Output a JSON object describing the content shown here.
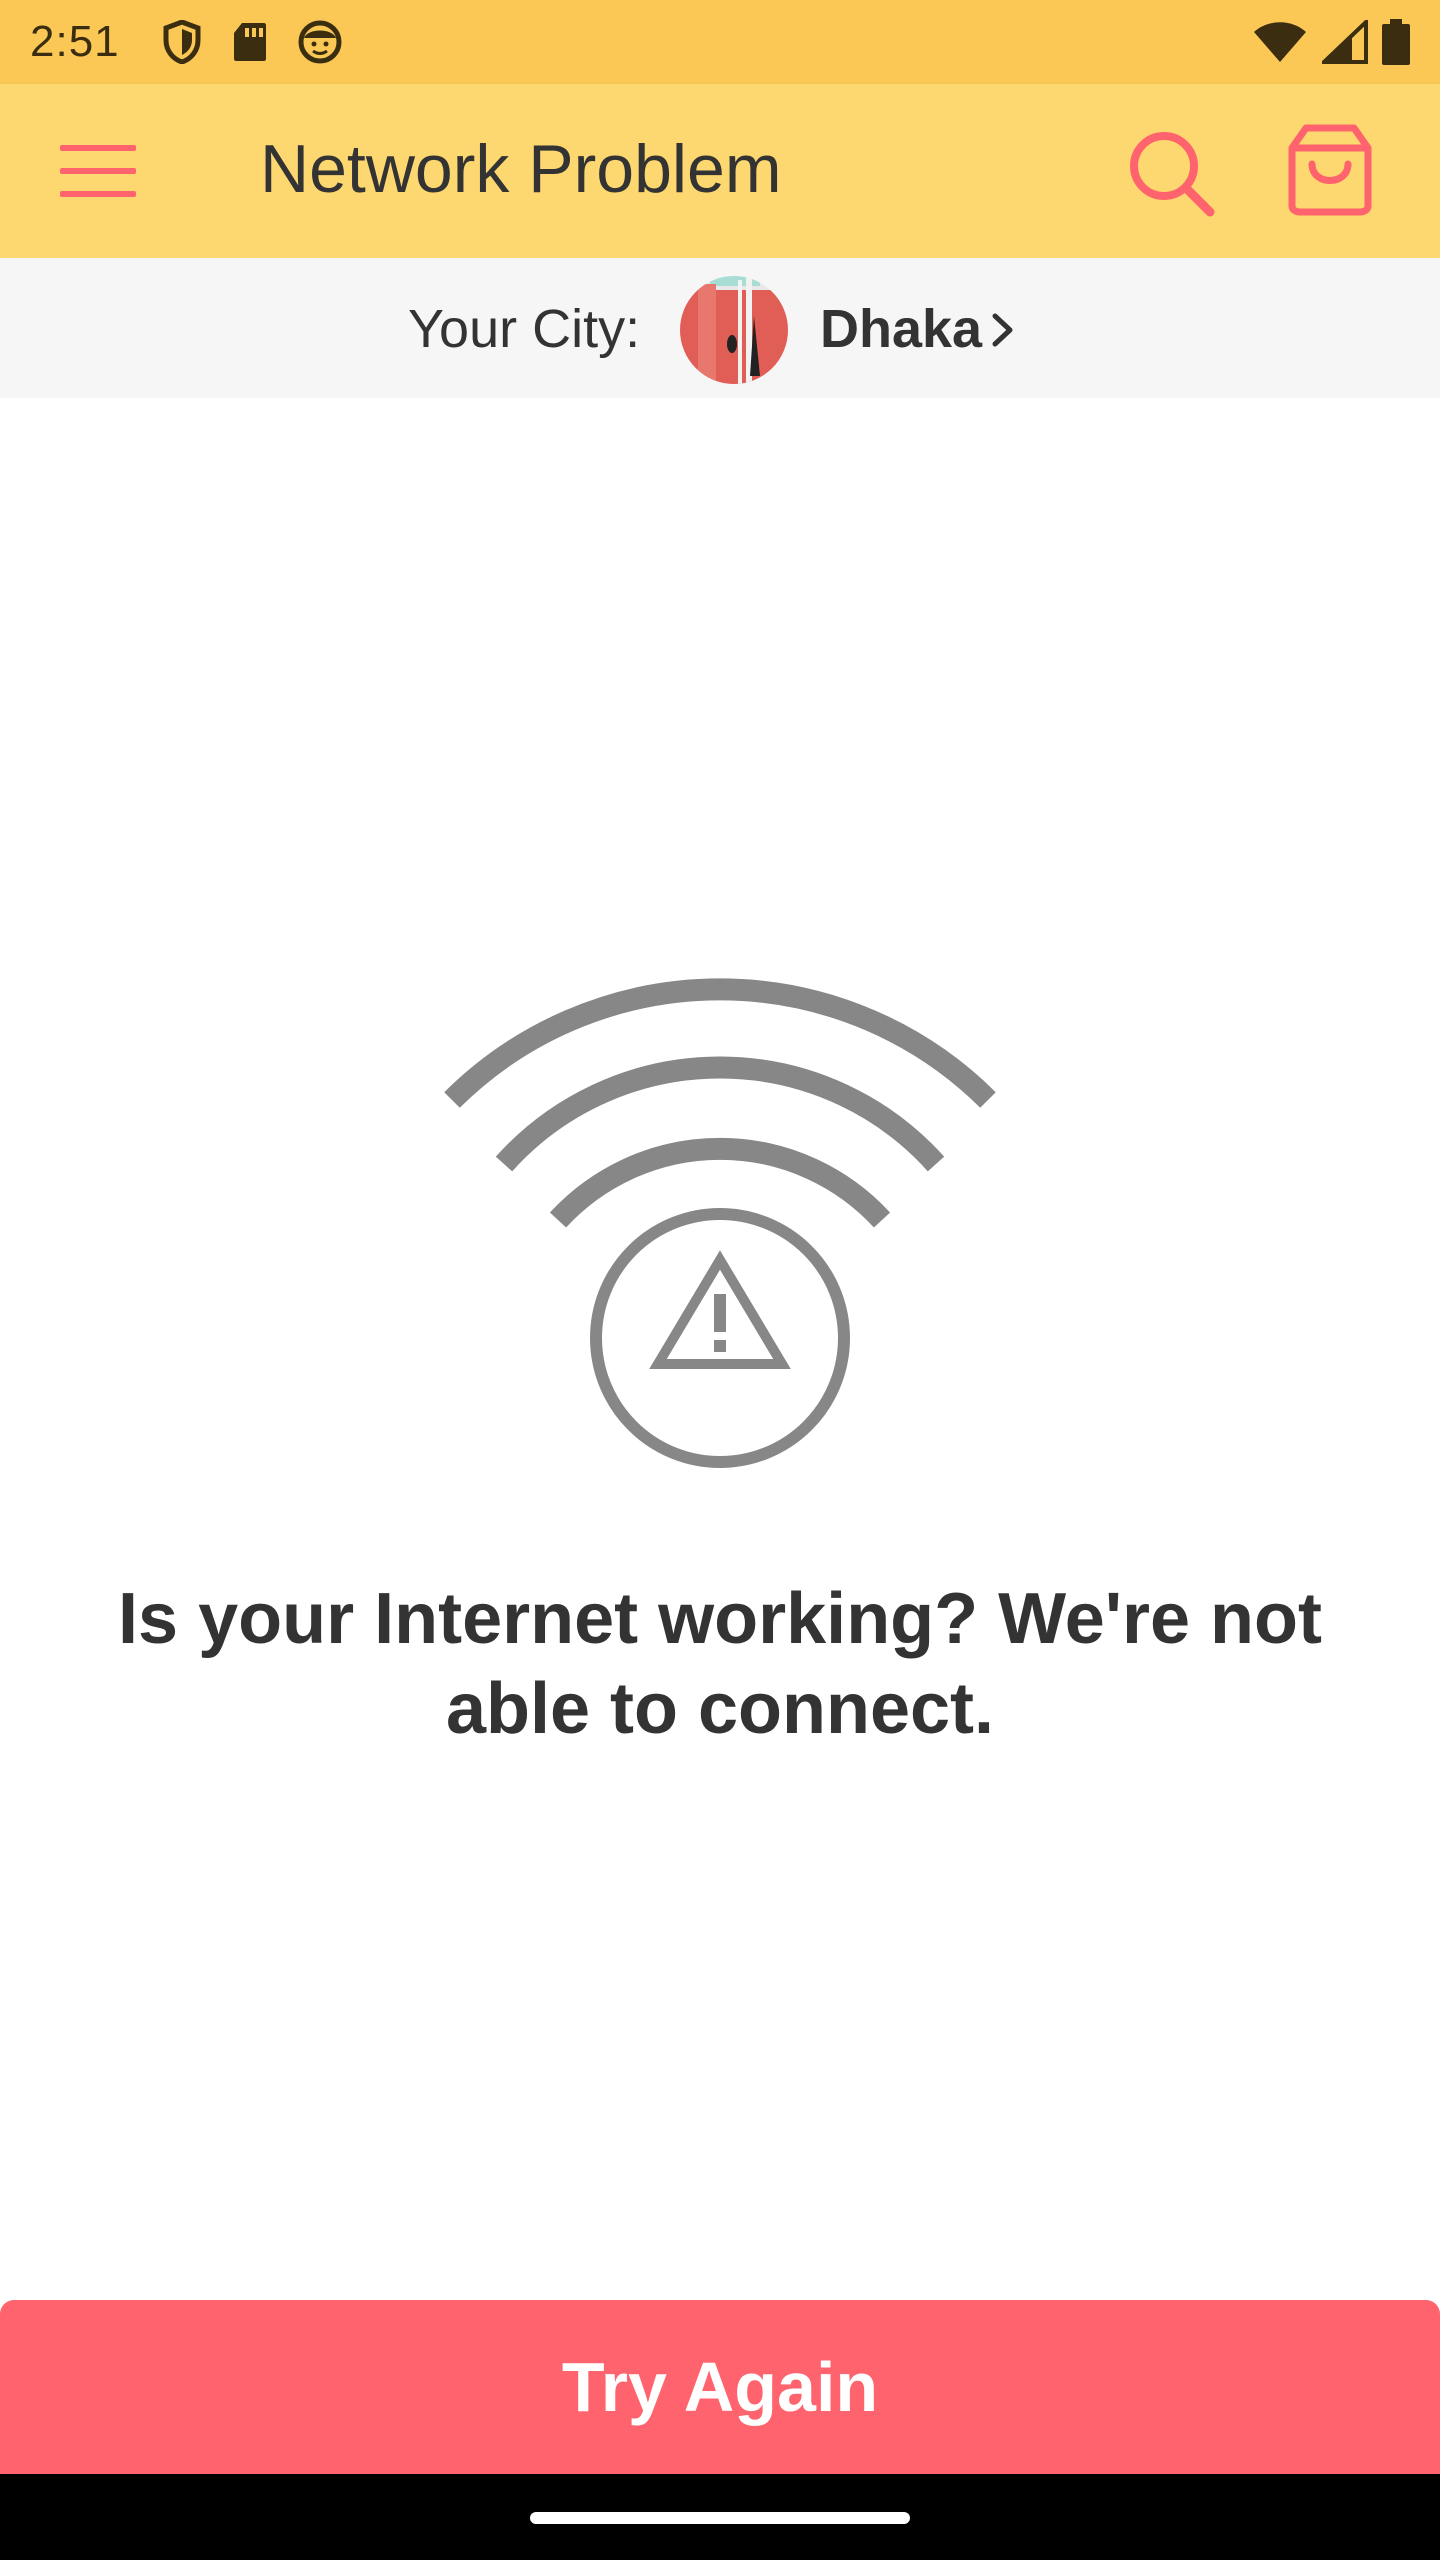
{
  "status_bar": {
    "time": "2:51",
    "left_icons": [
      "shield-icon",
      "sd-card-icon",
      "face-icon"
    ],
    "right_icons": [
      "wifi-icon",
      "cell-signal-icon",
      "battery-icon"
    ]
  },
  "app_bar": {
    "title": "Network Problem",
    "accent_color": "#ff646e",
    "background_color": "#fdd76f"
  },
  "city": {
    "label": "Your City:",
    "name": "Dhaka"
  },
  "content": {
    "illustration": "wifi-warning-icon",
    "message": "Is your Internet working? We're not able to connect."
  },
  "action": {
    "button_label": "Try Again",
    "button_color": "#ff646e"
  }
}
